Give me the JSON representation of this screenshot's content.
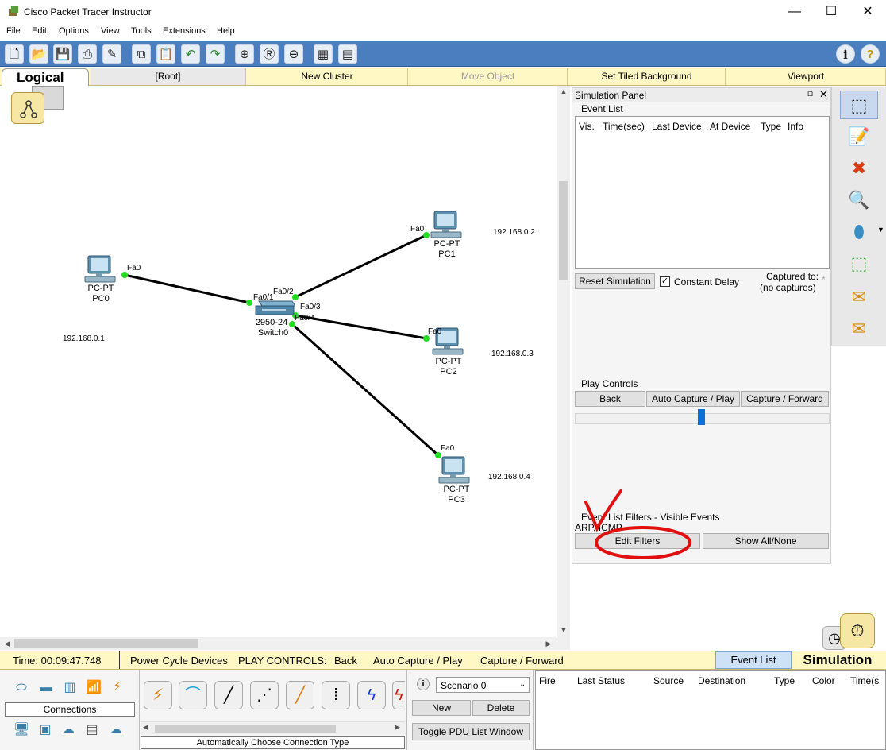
{
  "window": {
    "title": "Cisco Packet Tracer Instructor",
    "min": "—",
    "max": "☐",
    "close": "✕"
  },
  "menu": [
    "File",
    "Edit",
    "Options",
    "View",
    "Tools",
    "Extensions",
    "Help"
  ],
  "toolbar": {
    "icons": [
      "new-icon",
      "open-icon",
      "save-icon",
      "print-icon",
      "activity-wizard-icon",
      "copy-icon",
      "paste-icon",
      "undo-icon",
      "redo-icon",
      "zoom-in-icon",
      "zoom-reset-icon",
      "zoom-out-icon",
      "palette-icon",
      "custom-device-icon"
    ],
    "info": "i",
    "help": "?"
  },
  "logicalbar": {
    "logical": "Logical",
    "root": "[Root]",
    "new_cluster": "New Cluster",
    "move_object": "Move Object",
    "set_tiled_background": "Set Tiled Background",
    "viewport": "Viewport"
  },
  "topology": {
    "devices": [
      {
        "model": "PC-PT",
        "name": "PC0",
        "ip": "192.168.0.1",
        "port": "Fa0"
      },
      {
        "model": "PC-PT",
        "name": "PC1",
        "ip": "192.168.0.2",
        "port": "Fa0"
      },
      {
        "model": "PC-PT",
        "name": "PC2",
        "ip": "192.168.0.3",
        "port": "Fa0"
      },
      {
        "model": "PC-PT",
        "name": "PC3",
        "ip": "192.168.0.4",
        "port": "Fa0"
      }
    ],
    "switch": {
      "model": "2950-24",
      "name": "Switch0",
      "ports": [
        "Fa0/1",
        "Fa0/2",
        "Fa0/3",
        "Fa0/4"
      ]
    }
  },
  "sim_panel": {
    "title": "Simulation Panel",
    "event_list_title": "Event List",
    "columns": [
      "Vis.",
      "Time(sec)",
      "Last Device",
      "At Device",
      "Type",
      "Info"
    ],
    "reset_simulation": "Reset Simulation",
    "constant_delay": "Constant Delay",
    "constant_delay_checked": true,
    "captured_to_label": "Captured to:",
    "captured_to_value": "(no captures)",
    "play_controls_title": "Play Controls",
    "back": "Back",
    "auto_capture_play": "Auto Capture / Play",
    "capture_forward": "Capture / Forward",
    "filters_title": "Event List Filters - Visible Events",
    "filters_value": "ARP, ICMP",
    "edit_filters": "Edit Filters",
    "show_all_none": "Show All/None"
  },
  "statusbar": {
    "time": "Time: 00:09:47.748",
    "power_cycle": "Power Cycle Devices",
    "play_controls": "PLAY CONTROLS:",
    "back": "Back",
    "auto_capture": "Auto Capture / Play",
    "capture_forward": "Capture / Forward",
    "event_list": "Event List",
    "simulation": "Simulation"
  },
  "bottom": {
    "connections_label": "Connections",
    "connection_type_label": "Automatically Choose Connection Type",
    "scenario": "Scenario 0",
    "new": "New",
    "delete": "Delete",
    "toggle_pdu": "Toggle PDU List Window",
    "pdu_columns": [
      "Fire",
      "Last Status",
      "Source",
      "Destination",
      "Type",
      "Color",
      "Time(s"
    ]
  },
  "colors": {
    "toolbar_blue": "#4a7ebf",
    "status_yellow": "#fff8c4",
    "link_green": "#22dd22",
    "annotation_red": "#e01010"
  }
}
